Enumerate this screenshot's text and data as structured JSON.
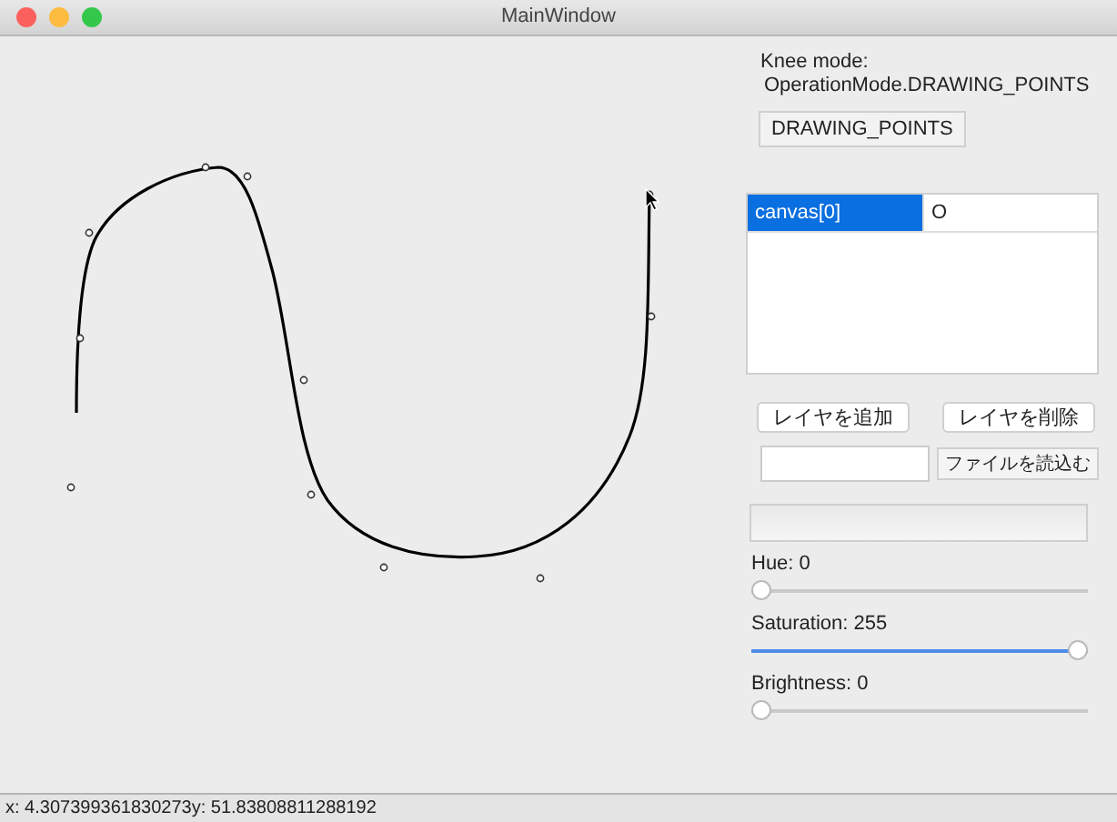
{
  "window": {
    "title": "MainWindow"
  },
  "knee_mode": {
    "label": "Knee mode:",
    "value": "OperationMode.DRAWING_POINTS"
  },
  "mode_button": "DRAWING_POINTS",
  "layer_table": {
    "rows": [
      {
        "cells": [
          "canvas[0]",
          "O"
        ],
        "selected": true
      }
    ]
  },
  "layer_buttons": [
    "レイヤを追加",
    "レイヤを削除"
  ],
  "load_button": "ファイルを読込む",
  "sliders": [
    {
      "label": "Hue: 0",
      "level": 0
    },
    {
      "label": "Saturation: 255",
      "level": 1
    },
    {
      "label": "Brightness: 0",
      "level": 0
    }
  ],
  "status_bar": "x: 4.307399361830273y: 51.83808811288192"
}
